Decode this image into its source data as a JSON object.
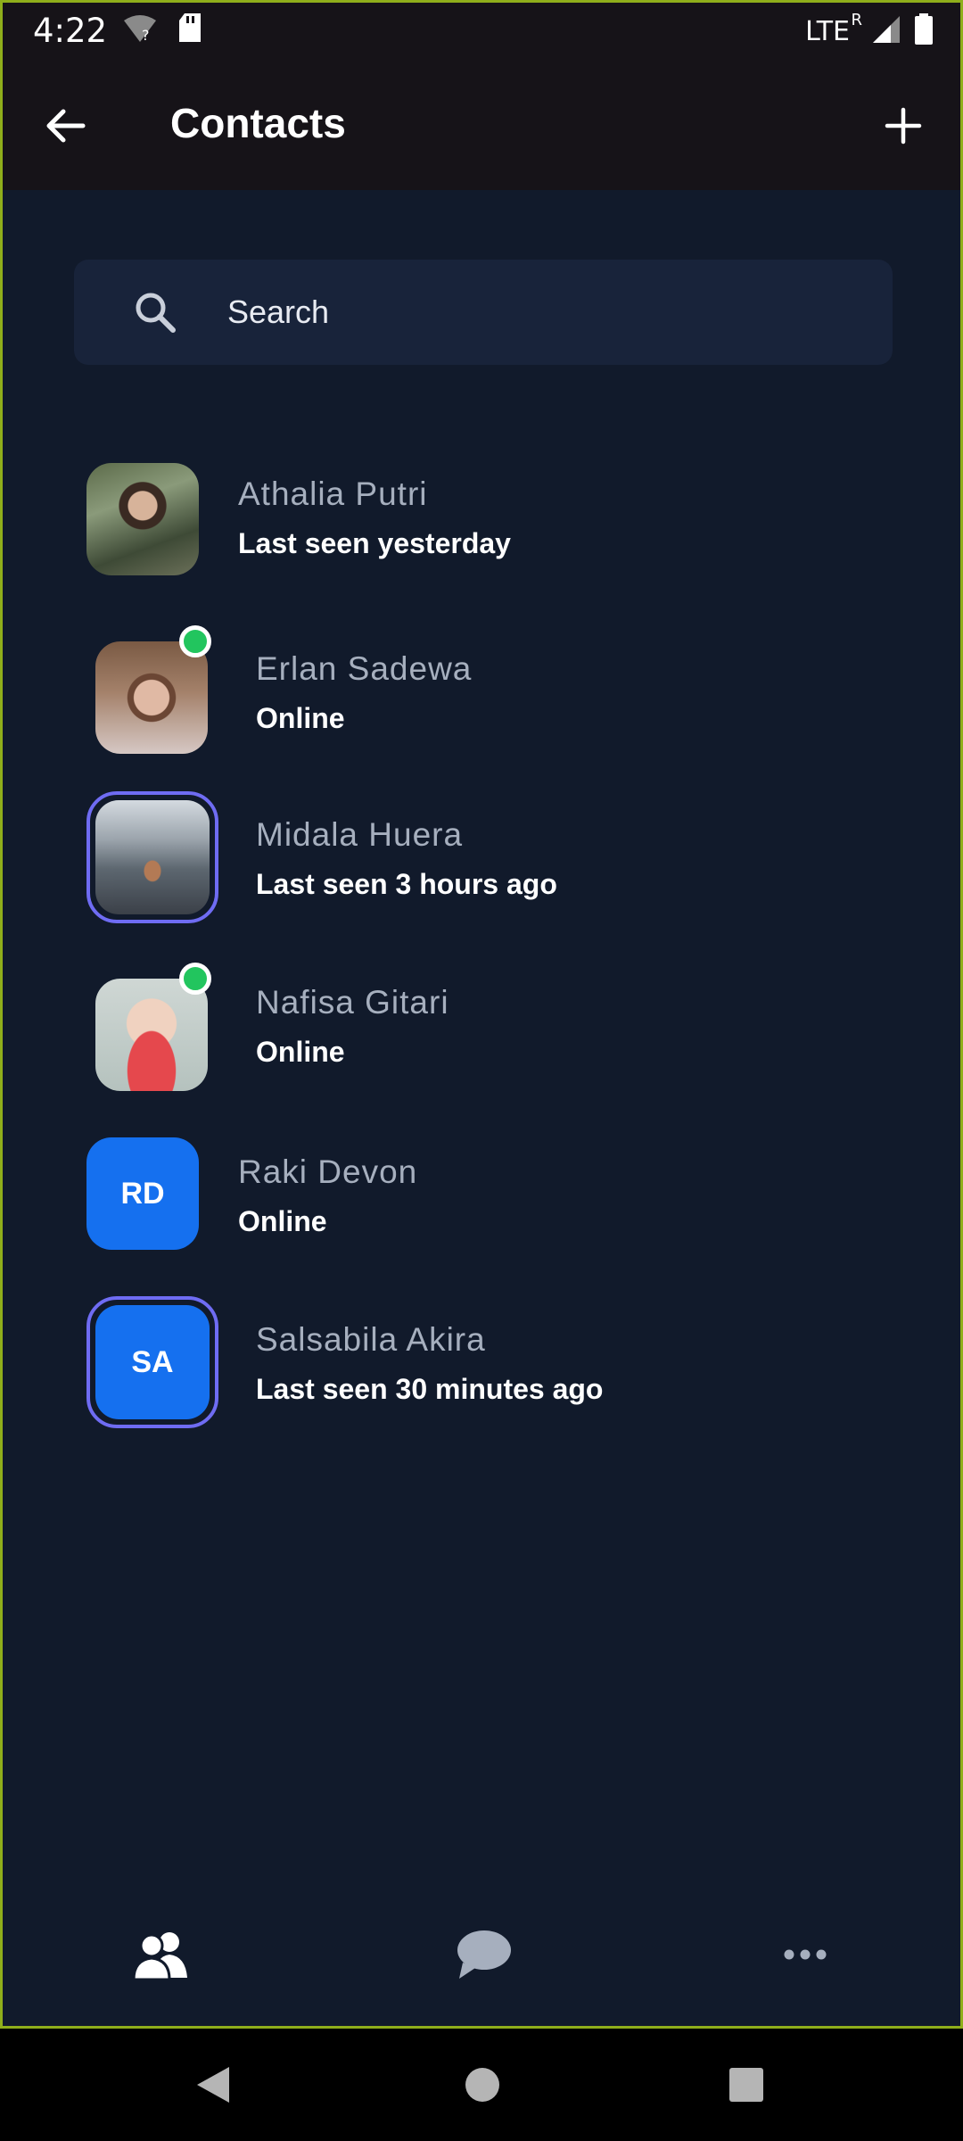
{
  "status_bar": {
    "time": "4:22",
    "network": "LTE",
    "roaming": "R",
    "icons": [
      "wifi-unknown-icon",
      "sd-card-icon",
      "signal-icon",
      "battery-icon"
    ]
  },
  "header": {
    "title": "Contacts",
    "back_icon": "arrow-left-icon",
    "add_icon": "plus-icon"
  },
  "search": {
    "placeholder": "Search",
    "icon": "search-icon"
  },
  "contacts": [
    {
      "name": "Athalia Putri",
      "status": "Last seen yesterday",
      "avatar": "photo",
      "online": false,
      "story": false
    },
    {
      "name": "Erlan Sadewa",
      "status": "Online",
      "avatar": "photo",
      "online": true,
      "story": false
    },
    {
      "name": "Midala Huera",
      "status": "Last seen 3 hours ago",
      "avatar": "photo",
      "online": false,
      "story": true
    },
    {
      "name": "Nafisa Gitari",
      "status": "Online",
      "avatar": "photo",
      "online": true,
      "story": false
    },
    {
      "name": "Raki Devon",
      "status": "Online",
      "avatar": "initials",
      "initials": "RD",
      "online": false,
      "story": false
    },
    {
      "name": "Salsabila Akira",
      "status": "Last seen 30 minutes ago",
      "avatar": "initials",
      "initials": "SA",
      "online": false,
      "story": true
    }
  ],
  "bottom_nav": [
    {
      "icon": "contacts-icon",
      "active": true
    },
    {
      "icon": "chat-bubble-icon",
      "active": false
    },
    {
      "icon": "more-icon",
      "active": false
    }
  ],
  "colors": {
    "background": "#111a2b",
    "appbar": "#161318",
    "search_bg": "#18233a",
    "accent_blue": "#1570ef",
    "story_ring": "#6f6cf3",
    "online_green": "#22c55e",
    "name_text": "#a6afbe"
  }
}
